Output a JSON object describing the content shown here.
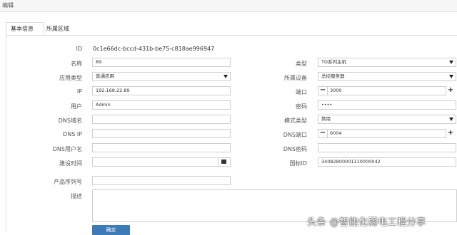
{
  "window": {
    "title": "编辑"
  },
  "tabs": [
    {
      "label": "基本信息"
    },
    {
      "label": "所属区域"
    }
  ],
  "form": {
    "id": {
      "label": "ID",
      "value": "0c1e66dc-bccd-431b-be75-c818ae996947"
    },
    "name": {
      "label": "名称",
      "value": "89"
    },
    "app_type": {
      "label": "应用类型",
      "value": "普通应用"
    },
    "ip": {
      "label": "IP",
      "value": "192.168.22.89"
    },
    "user": {
      "label": "用户",
      "value": "Admin"
    },
    "dns_domain": {
      "label": "DNS域名",
      "value": ""
    },
    "dns_ip": {
      "label": "DNS IP",
      "value": ""
    },
    "dns_user": {
      "label": "DNS用户名",
      "value": ""
    },
    "build_time": {
      "label": "建设时间",
      "value": ""
    },
    "product_serial": {
      "label": "产品序列号",
      "value": ""
    },
    "description": {
      "label": "描述",
      "value": ""
    },
    "type": {
      "label": "类型",
      "value": "TD系列主机"
    },
    "device": {
      "label": "所属设备",
      "value": "总控服务器"
    },
    "port": {
      "label": "端口",
      "value": "3000"
    },
    "password": {
      "label": "密码",
      "value": "••••"
    },
    "mode_type": {
      "label": "模式类型",
      "value": "禁用"
    },
    "dns_port": {
      "label": "DNS端口",
      "value": "6004"
    },
    "dns_password": {
      "label": "DNS密码",
      "value": ""
    },
    "gb_id": {
      "label": "国标ID",
      "value": "34082800001110000042"
    }
  },
  "buttons": {
    "ok": "确定",
    "minus": "−",
    "plus": "+"
  },
  "watermark": "头条 @智能化弱电工程分享",
  "colors": {
    "primary": "#3d7ab8",
    "border": "#cfcfcf"
  }
}
